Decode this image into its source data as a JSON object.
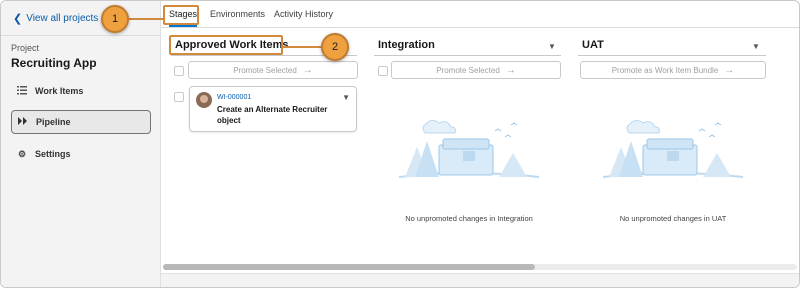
{
  "sidebar": {
    "back_link": "View all projects",
    "project_caption": "Project",
    "project_name": "Recruiting App",
    "items": [
      {
        "label": "Work Items",
        "icon": "list-icon"
      },
      {
        "label": "Pipeline",
        "icon": "pipeline-icon",
        "active": true
      },
      {
        "label": "Settings",
        "icon": "gear-icon"
      }
    ]
  },
  "tabs": [
    {
      "label": "Stages",
      "active": true
    },
    {
      "label": "Environments"
    },
    {
      "label": "Activity History"
    }
  ],
  "columns": [
    {
      "title": "Approved Work Items",
      "promote_label": "Promote Selected",
      "cards": [
        {
          "id": "WI-000001",
          "title": "Create an Alternate Recruiter object"
        }
      ]
    },
    {
      "title": "Integration",
      "promote_label": "Promote Selected",
      "empty_message": "No unpromoted changes in Integration"
    },
    {
      "title": "UAT",
      "promote_label": "Promote as Work Item Bundle",
      "empty_message": "No unpromoted changes in UAT"
    }
  ],
  "callouts": [
    "1",
    "2"
  ],
  "colors": {
    "accent": "#0176d3",
    "link": "#0b5cab",
    "callout": "#efa13f",
    "callout_border": "#d1893d",
    "illustration": "#bcd9f0"
  }
}
